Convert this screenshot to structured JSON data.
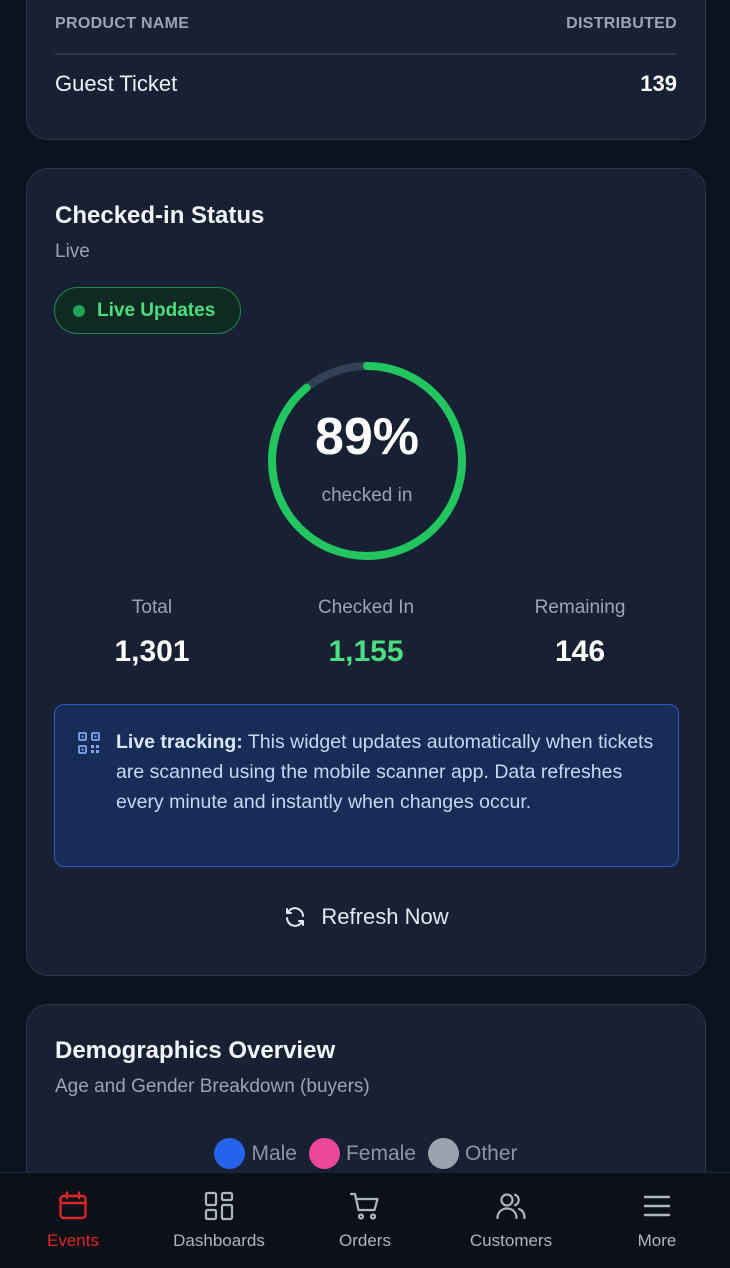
{
  "products": {
    "col_product": "PRODUCT NAME",
    "col_distributed": "DISTRIBUTED",
    "rows": [
      {
        "name": "Guest Ticket",
        "distributed": "139"
      }
    ]
  },
  "checkin": {
    "title": "Checked-in Status",
    "subtitle": "Live",
    "live_badge": "Live Updates",
    "progress_fraction": 0.89,
    "percent_text": "89%",
    "percent_caption": "checked in",
    "stats": {
      "total_label": "Total",
      "total_value": "1,301",
      "checked_label": "Checked In",
      "checked_value": "1,155",
      "remaining_label": "Remaining",
      "remaining_value": "146"
    },
    "info": {
      "bold": "Live tracking:",
      "text": " This widget updates automatically when tickets are scanned using the mobile scanner app. Data refreshes every minute and instantly when changes occur."
    },
    "refresh_label": "Refresh Now",
    "colors": {
      "progress": "#22c55e",
      "track": "#334155",
      "accent_green": "#4ade80"
    }
  },
  "demographics": {
    "title": "Demographics Overview",
    "subtitle": "Age and Gender Breakdown (buyers)",
    "legend": [
      {
        "label": "Male",
        "color": "#2563eb"
      },
      {
        "label": "Female",
        "color": "#ec4899"
      },
      {
        "label": "Other",
        "color": "#9ca3af"
      }
    ]
  },
  "nav": {
    "items": [
      {
        "label": "Events",
        "icon": "calendar-icon",
        "active": true
      },
      {
        "label": "Dashboards",
        "icon": "grid-icon",
        "active": false
      },
      {
        "label": "Orders",
        "icon": "cart-icon",
        "active": false
      },
      {
        "label": "Customers",
        "icon": "users-icon",
        "active": false
      },
      {
        "label": "More",
        "icon": "menu-icon",
        "active": false
      }
    ],
    "active_color": "#dc2626"
  }
}
